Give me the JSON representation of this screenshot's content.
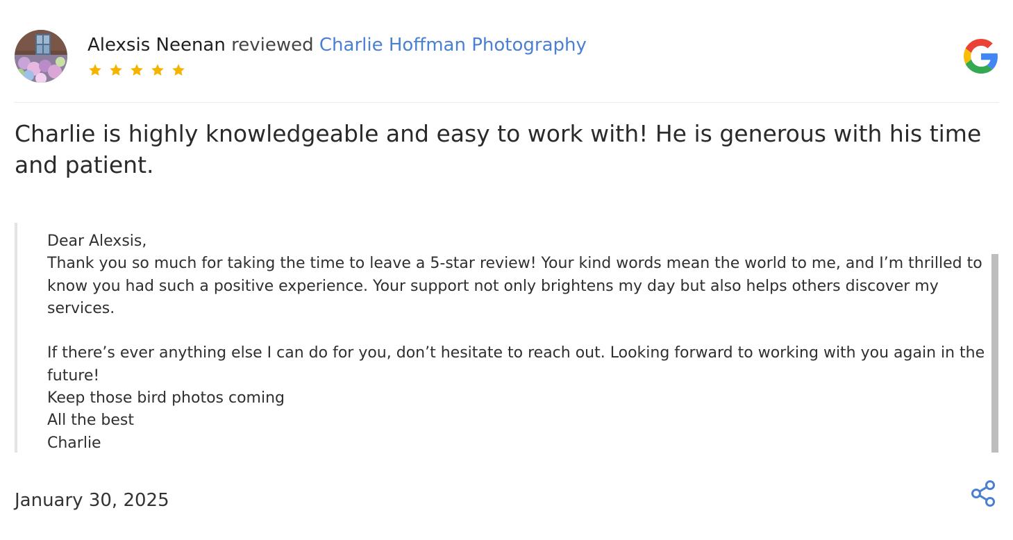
{
  "review": {
    "reviewer_name": "Alexsis Neenan",
    "reviewed_word": "reviewed",
    "business_name": "Charlie Hoffman Photography",
    "rating": 5,
    "text": "Charlie is highly knowledgeable and easy to work with! He is generous with his time and patient.",
    "date": "January 30, 2025"
  },
  "reply": {
    "text": "Dear Alexsis,\nThank you so much for taking the time to leave a 5-star review! Your kind words mean the world to me, and I’m thrilled to know you had such a positive experience. Your support not only brightens my day but also helps others discover my services.\n\nIf there’s ever anything else I can do for you, don’t hesitate to reach out. Looking forward to working with you again in the future!\nKeep those bird photos coming\nAll the best\nCharlie"
  },
  "icons": {
    "avatar": "reviewer-avatar",
    "star": "star-icon",
    "source": "google-logo",
    "share": "share-icon"
  },
  "colors": {
    "business_link": "#4a7fd4",
    "star": "#f4b400",
    "share_icon": "#4a7fd4",
    "scrollbar": "#bdbdbd"
  }
}
